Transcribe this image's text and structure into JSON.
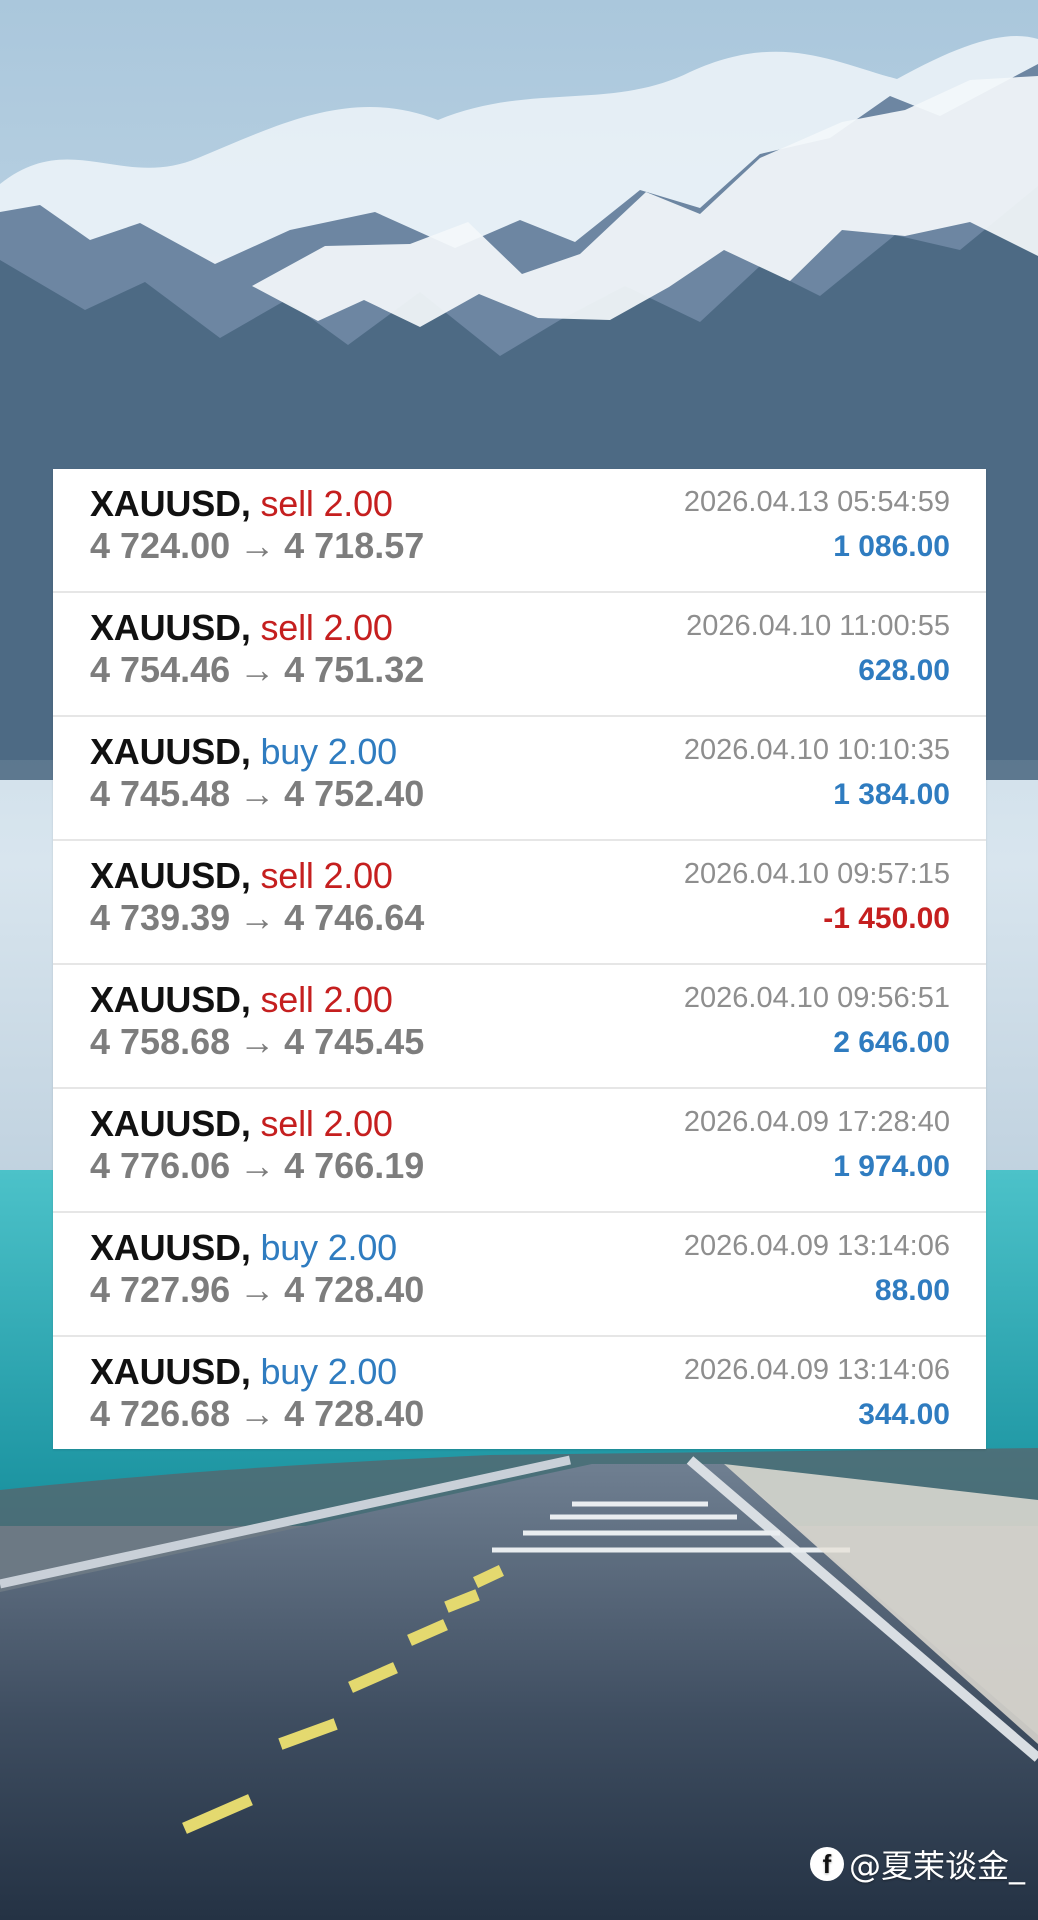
{
  "trades": [
    {
      "symbol": "XAUUSD",
      "side": "sell",
      "volume": "2.00",
      "open_price": "4 724.00",
      "close_price": "4 718.57",
      "time": "2026.04.13 05:54:59",
      "profit": "1 086.00"
    },
    {
      "symbol": "XAUUSD",
      "side": "sell",
      "volume": "2.00",
      "open_price": "4 754.46",
      "close_price": "4 751.32",
      "time": "2026.04.10 11:00:55",
      "profit": "628.00"
    },
    {
      "symbol": "XAUUSD",
      "side": "buy",
      "volume": "2.00",
      "open_price": "4 745.48",
      "close_price": "4 752.40",
      "time": "2026.04.10 10:10:35",
      "profit": "1 384.00"
    },
    {
      "symbol": "XAUUSD",
      "side": "sell",
      "volume": "2.00",
      "open_price": "4 739.39",
      "close_price": "4 746.64",
      "time": "2026.04.10 09:57:15",
      "profit": "-1 450.00"
    },
    {
      "symbol": "XAUUSD",
      "side": "sell",
      "volume": "2.00",
      "open_price": "4 758.68",
      "close_price": "4 745.45",
      "time": "2026.04.10 09:56:51",
      "profit": "2 646.00"
    },
    {
      "symbol": "XAUUSD",
      "side": "sell",
      "volume": "2.00",
      "open_price": "4 776.06",
      "close_price": "4 766.19",
      "time": "2026.04.09 17:28:40",
      "profit": "1 974.00"
    },
    {
      "symbol": "XAUUSD",
      "side": "buy",
      "volume": "2.00",
      "open_price": "4 727.96",
      "close_price": "4 728.40",
      "time": "2026.04.09 13:14:06",
      "profit": "88.00"
    },
    {
      "symbol": "XAUUSD",
      "side": "buy",
      "volume": "2.00",
      "open_price": "4 726.68",
      "close_price": "4 728.40",
      "time": "2026.04.09 13:14:06",
      "profit": "344.00"
    }
  ],
  "symbols": {
    "comma": ",",
    "arrow": "→",
    "facebook_icon": "f"
  },
  "watermark": {
    "text": "@夏茉谈金_",
    "icon": "facebook-icon"
  },
  "colors": {
    "sell": "#c51f1f",
    "buy": "#2f7cc0",
    "positive_profit": "#2f7cc0",
    "negative_profit": "#c51f1f",
    "price_text": "#7d7d7d",
    "time_text": "#8e8e8e"
  }
}
